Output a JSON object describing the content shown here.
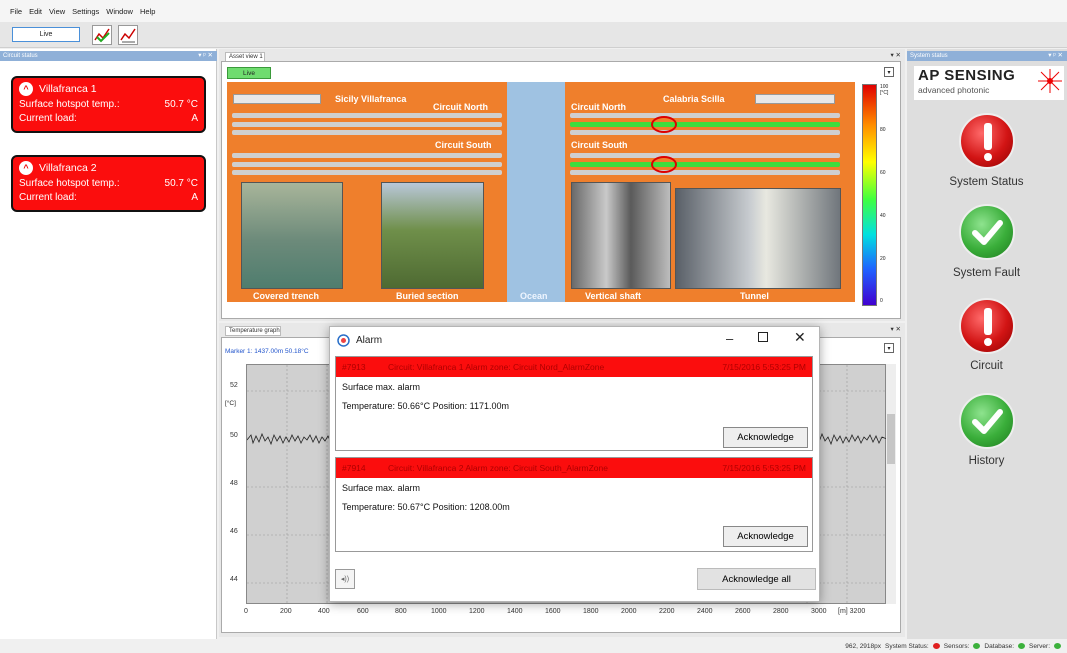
{
  "menu": [
    "File",
    "Edit",
    "View",
    "Settings",
    "Window",
    "Help"
  ],
  "toolbar": {
    "mode_value": "Live"
  },
  "circuit_status": {
    "title": "Circuit status",
    "circuits": [
      {
        "name": "Villafranca 1",
        "hotspot_label": "Surface hotspot temp.:",
        "hotspot_value": "50.7 °C",
        "load_label": "Current load:",
        "load_unit": "A"
      },
      {
        "name": "Villafranca 2",
        "hotspot_label": "Surface hotspot temp.:",
        "hotspot_value": "50.7 °C",
        "load_label": "Current load:",
        "load_unit": "A"
      }
    ]
  },
  "asset_view": {
    "tab": "Asset view 1",
    "live_label": "Live",
    "left_title": "Sicily Villafranca",
    "right_title": "Calabria Scilla",
    "circuit_north": "Circuit North",
    "circuit_south": "Circuit South",
    "ocean": "Ocean",
    "labels": [
      "Covered trench",
      "Buried section",
      "Vertical shaft",
      "Tunnel"
    ],
    "scale_ticks": [
      "100\n[°C]",
      "80",
      "60",
      "40",
      "20",
      "0"
    ]
  },
  "temperature_graph": {
    "tab": "Temperature graph",
    "marker": "Marker 1: 1437.00m 50.18°C",
    "y_unit": "[°C]",
    "y_ticks": [
      "52",
      "50",
      "48",
      "46",
      "44"
    ],
    "x_ticks": [
      "0",
      "200",
      "400",
      "600",
      "800",
      "1000",
      "1200",
      "1400",
      "1600",
      "1800",
      "2000",
      "2200",
      "2400",
      "2600",
      "2800",
      "3000",
      "[m] 3200"
    ]
  },
  "alarm_dialog": {
    "title": "Alarm",
    "alarms": [
      {
        "id": "#7913",
        "text": "Circuit: Villafranca 1 Alarm zone: Circuit Nord_AlarmZone",
        "time": "7/15/2016 5:53:25 PM",
        "type": "Surface max. alarm",
        "detail": "Temperature: 50.66°C  Position: 1171.00m",
        "button": "Acknowledge"
      },
      {
        "id": "#7914",
        "text": "Circuit: Villafranca 2 Alarm zone: Circuit South_AlarmZone",
        "time": "7/15/2016 5:53:25 PM",
        "type": "Surface max. alarm",
        "detail": "Temperature: 50.67°C  Position: 1208.00m",
        "button": "Acknowledge"
      }
    ],
    "ack_all": "Acknowledge all"
  },
  "system_status": {
    "title": "System status",
    "brand": "AP SENSING",
    "brand_sub": "advanced photonic",
    "items": [
      {
        "label": "System Status",
        "state": "error"
      },
      {
        "label": "System Fault",
        "state": "ok"
      },
      {
        "label": "Circuit",
        "state": "error"
      },
      {
        "label": "History",
        "state": "ok"
      }
    ]
  },
  "statusbar": {
    "coords": "962, 2918px",
    "items": [
      {
        "label": "System Status:",
        "color": "#e02020"
      },
      {
        "label": "Sensors:",
        "color": "#3cb13c"
      },
      {
        "label": "Database:",
        "color": "#3cb13c"
      },
      {
        "label": "Server:",
        "color": "#3cb13c"
      }
    ]
  }
}
